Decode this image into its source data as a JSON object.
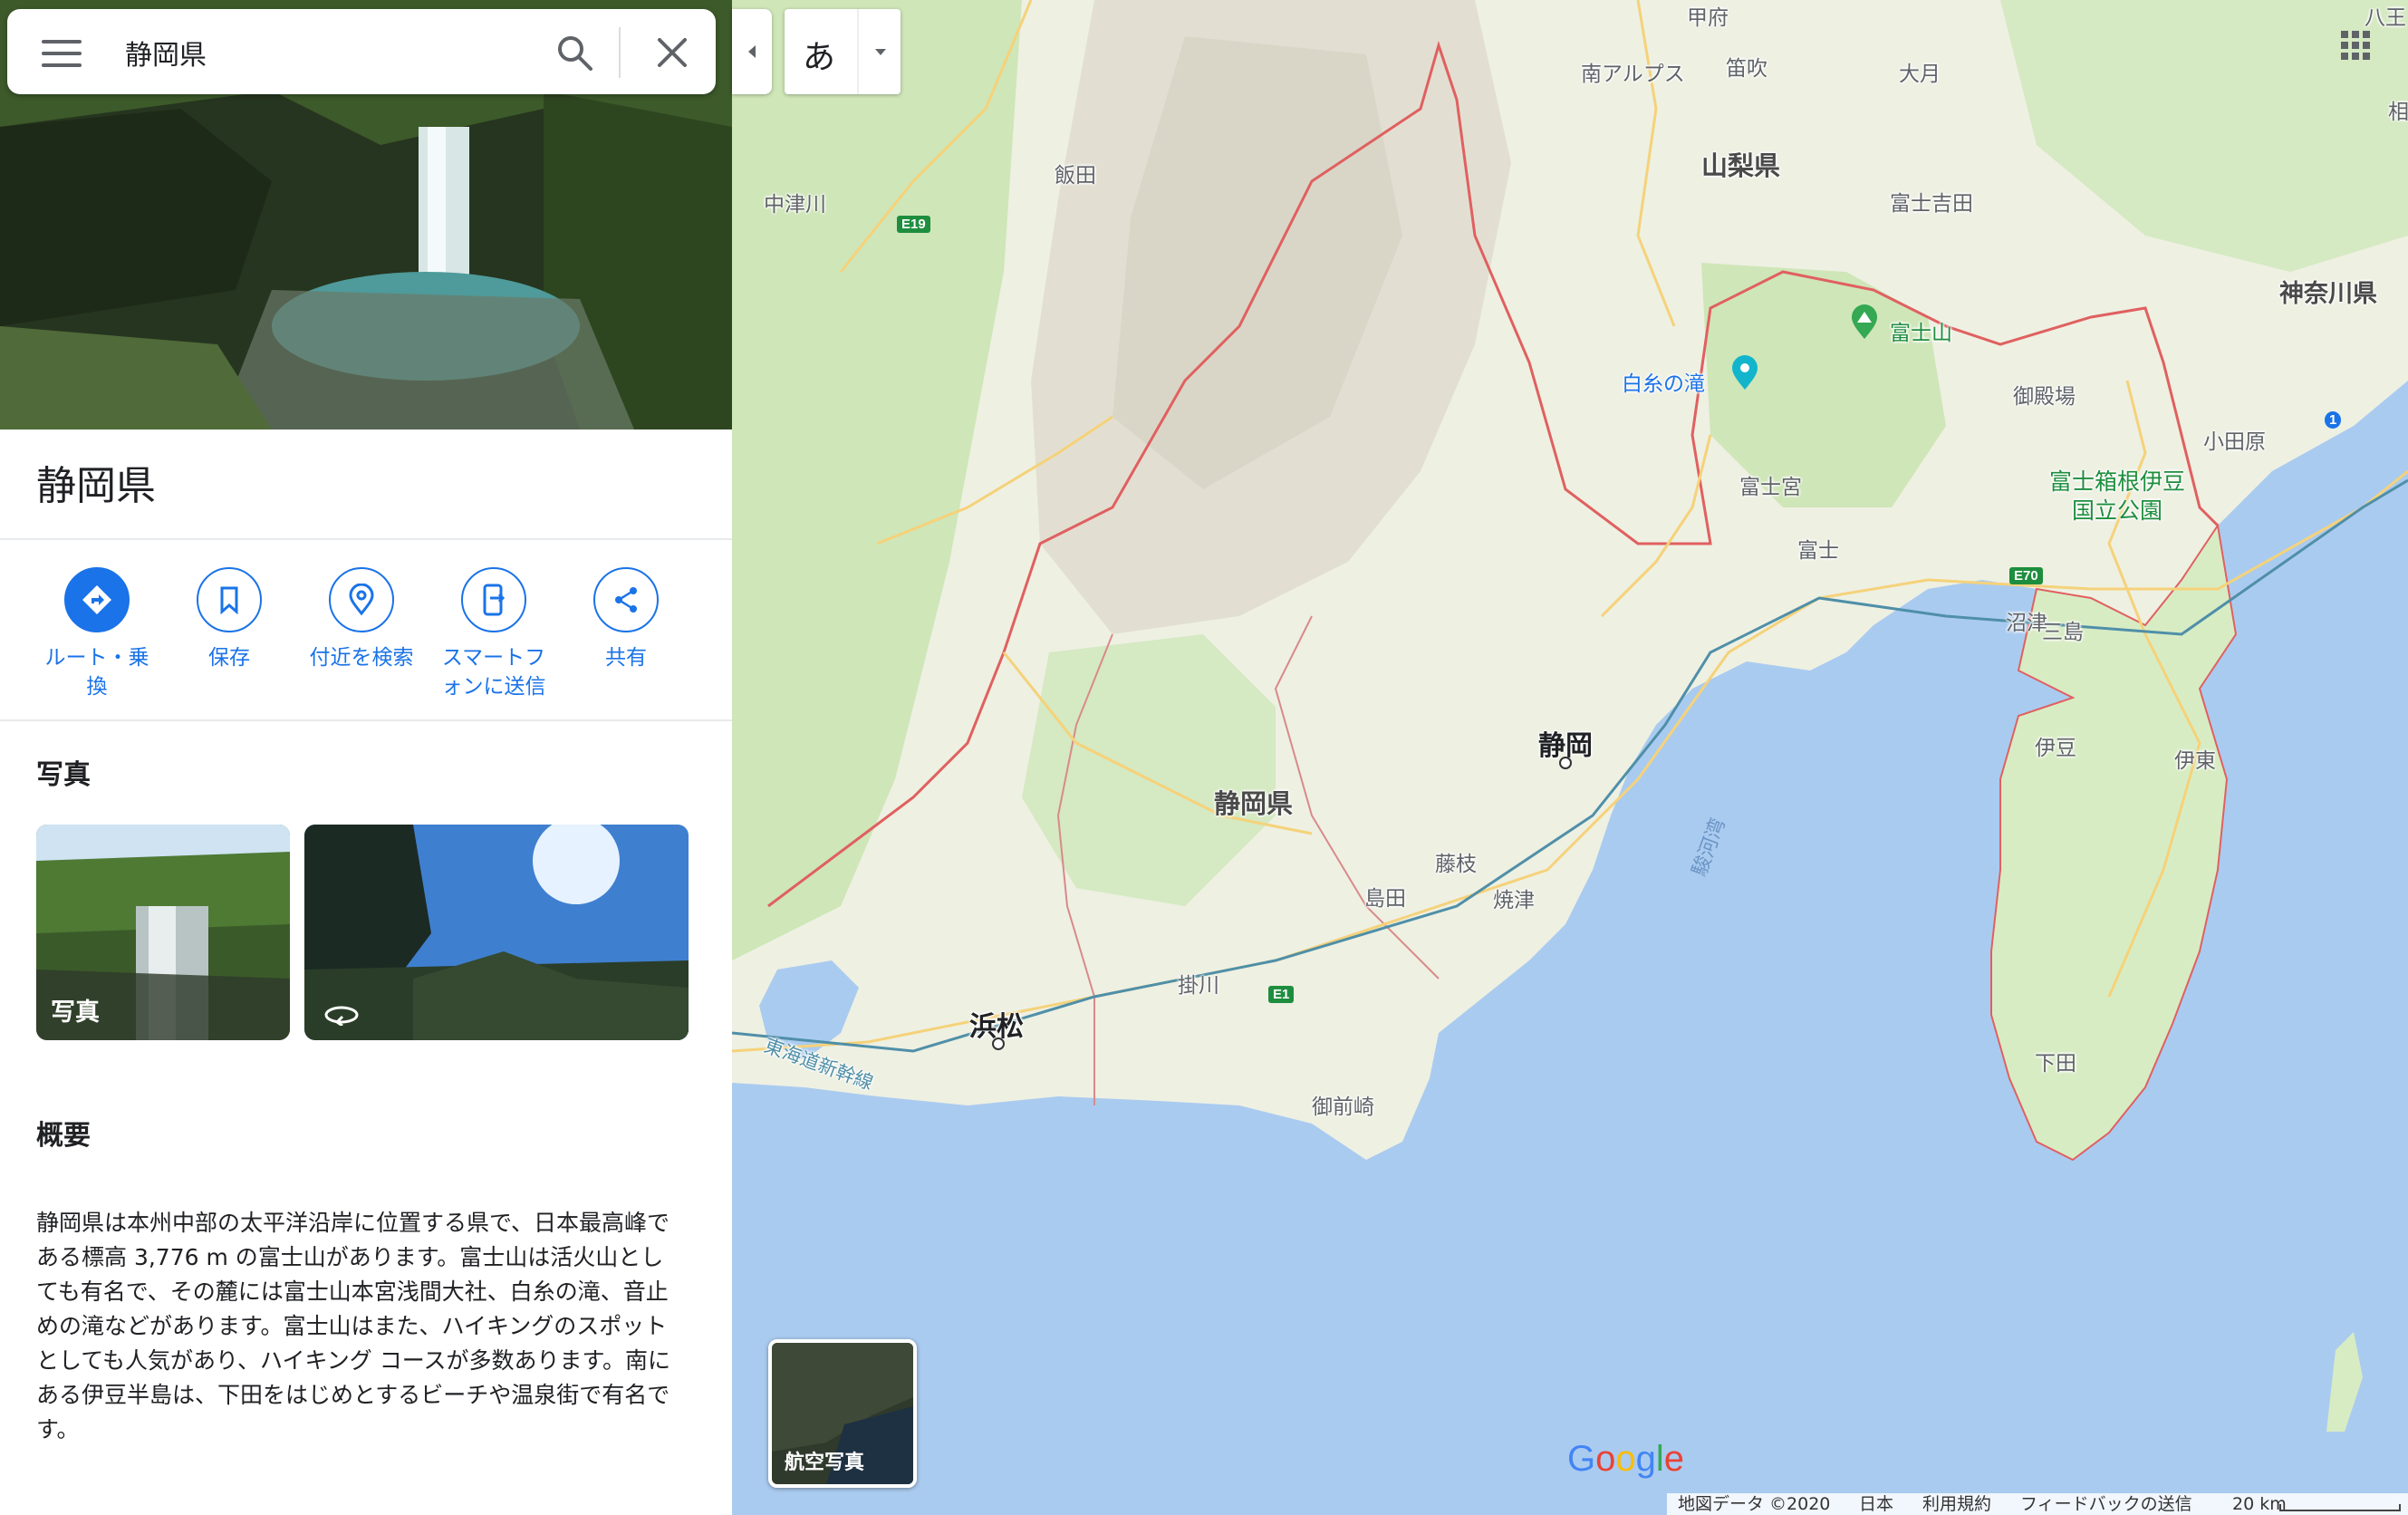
{
  "search": {
    "value": "静岡県"
  },
  "place": {
    "title": "静岡県"
  },
  "actions": [
    {
      "label": "ルート・乗\n換"
    },
    {
      "label": "保存"
    },
    {
      "label": "付近を検索"
    },
    {
      "label": "スマートフ\nォンに送信"
    },
    {
      "label": "共有"
    }
  ],
  "photos": {
    "heading": "写真",
    "first_label": "写真"
  },
  "overview": {
    "heading": "概要",
    "text": "静岡県は本州中部の太平洋沿岸に位置する県で、日本最高峰である標高 3,776 m の富士山があります。富士山は活火山としても有名で、その麓には富士山本宮浅間大社、白糸の滝、音止めの滝などがあります。富士山はまた、ハイキングのスポットとしても人気があり、ハイキング コースが多数あります。南にある伊豆半島は、下田をはじめとするビーチや温泉街で有名です。"
  },
  "ime": {
    "label": "あ"
  },
  "aerial": {
    "label": "航空写真"
  },
  "google_logo": "Google",
  "footer": {
    "map_data": "地図データ ©2020",
    "country": "日本",
    "terms": "利用規約",
    "feedback": "フィードバックの送信",
    "scale": "20 km"
  },
  "map_labels": {
    "kofu": "甲府",
    "minami_alps": "南アルプス",
    "fuefuki": "笛吹",
    "otsuki": "大月",
    "yamanashi": "山梨県",
    "fujiyoshida": "富士吉田",
    "kanagawa": "神奈川県",
    "iida": "飯田",
    "nakatsugawa": "中津川",
    "fujisan": "富士山",
    "shiraito": "白糸の滝",
    "gotemba": "御殿場",
    "odawara": "小田原",
    "fujinomiya": "富士宮",
    "fuji_hakone": "富士箱根伊豆\n国立公園",
    "fuji": "富士",
    "numazu": "沼津",
    "mishima": "三島",
    "shizuoka": "静岡",
    "shizuoka_pref": "静岡県",
    "izu": "伊豆",
    "ito": "伊東",
    "fujieda": "藤枝",
    "shimada": "島田",
    "yaizu": "焼津",
    "suruga_bay": "駿河湾",
    "kakegawa": "掛川",
    "hamamatsu": "浜松",
    "tokaido": "東海道新幹線",
    "omaezaki": "御前崎",
    "shimoda": "下田",
    "yatsu": "八王",
    "sagami": "相"
  },
  "shields": {
    "e19": "E19",
    "e70": "E70",
    "e1": "E1",
    "r1": "1"
  },
  "colors": {
    "accent": "#1a73e8",
    "water": "#aacbf0",
    "land": "#f1f0e6",
    "park": "#cfe6b8",
    "border": "#e06060"
  }
}
